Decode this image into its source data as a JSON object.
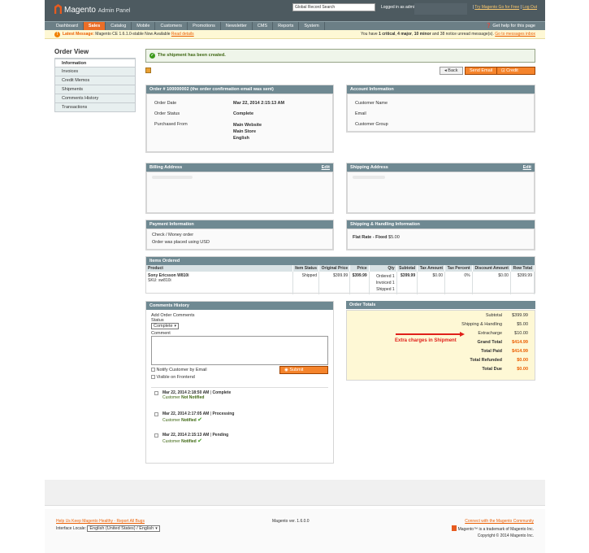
{
  "header": {
    "logo_text": "Magento",
    "logo_suffix": "Admin Panel",
    "search_value": "Global Record Search",
    "logged_in": "Logged in as admin",
    "links": [
      "Try Magento Go for Free",
      "Log Out"
    ]
  },
  "nav": {
    "items": [
      "Dashboard",
      "Sales",
      "Catalog",
      "Mobile",
      "Customers",
      "Promotions",
      "Newsletter",
      "CMS",
      "Reports",
      "System"
    ],
    "active": "Sales",
    "help": "Get help for this page"
  },
  "message_bar": {
    "label": "Latest Message:",
    "text": "Magento CE 1.6.1.0-stable Now Available",
    "read_details": "Read details",
    "counts_prefix": "You have",
    "critical": "1 critical",
    "major": "4 major",
    "minor": "10 minor",
    "rest": "and 38 notice unread message(s).",
    "go_link": "Go to messages inbox"
  },
  "sidebar": {
    "title": "Order View",
    "tabs": [
      "Information",
      "Invoices",
      "Credit Memos",
      "Shipments",
      "Comments History",
      "Transactions"
    ]
  },
  "success": "The shipment has been created.",
  "buttons": {
    "back": "Back",
    "send_email": "Send Email",
    "credit_memo": "Credit Memo"
  },
  "order": {
    "title": "Order # 100000002 (the order confirmation email was sent)",
    "date_label": "Order Date",
    "date": "Mar 22, 2014 2:15:13 AM",
    "status_label": "Order Status",
    "status": "Complete",
    "purchased_label": "Purchased From",
    "purchased": [
      "Main Website",
      "Main Store",
      "English"
    ]
  },
  "account": {
    "title": "Account Information",
    "fields": [
      "Customer Name",
      "Email",
      "Customer Group"
    ]
  },
  "billing": {
    "title": "Billing Address",
    "edit": "Edit"
  },
  "shipping_addr": {
    "title": "Shipping Address",
    "edit": "Edit"
  },
  "payment": {
    "title": "Payment Information",
    "lines": [
      "Check / Money order",
      "Order was placed using USD"
    ]
  },
  "shipping_method": {
    "title": "Shipping & Handling Information",
    "name": "Flat Rate - Fixed",
    "price": "$5.00"
  },
  "items": {
    "title": "Items Ordered",
    "columns": [
      "Product",
      "Item Status",
      "Original Price",
      "Price",
      "Qty",
      "Subtotal",
      "Tax Amount",
      "Tax Percent",
      "Discount Amount",
      "Row Total"
    ],
    "row": {
      "product": "Sony Ericsson W810i",
      "sku": "SKU: sw810i",
      "status": "Shipped",
      "original_price": "$399.99",
      "price": "$399.99",
      "qty": [
        "Ordered 1",
        "Invoiced 1",
        "Shipped 1"
      ],
      "subtotal": "$399.99",
      "tax_amount": "$0.00",
      "tax_percent": "0%",
      "discount": "$0.00",
      "row_total": "$399.99"
    }
  },
  "comments": {
    "title": "Comments History",
    "add_label": "Add Order Comments",
    "status_label": "Status",
    "status_value": "Complete",
    "comment_label": "Comment",
    "notify": "Notify Customer by Email",
    "visible": "Visible on Frontend",
    "submit": "Submit Comment",
    "history": [
      {
        "date": "Mar 22, 2014 2:18:50 AM",
        "sep": "|",
        "status": "Complete",
        "note_prefix": "Customer",
        "note": "Not Notified"
      },
      {
        "date": "Mar 22, 2014 2:17:05 AM",
        "sep": "|",
        "status": "Processing",
        "note_prefix": "Customer",
        "note": "Notified"
      },
      {
        "date": "Mar 22, 2014 2:15:13 AM",
        "sep": "|",
        "status": "Pending",
        "note_prefix": "Customer",
        "note": "Notified"
      }
    ]
  },
  "totals": {
    "title": "Order Totals",
    "rows": [
      {
        "label": "Subtotal",
        "value": "$399.99"
      },
      {
        "label": "Shipping & Handling",
        "value": "$5.00"
      },
      {
        "label": "Extracharge",
        "value": "$10.00"
      },
      {
        "label": "Grand Total",
        "value": "$414.99"
      },
      {
        "label": "Total Paid",
        "value": "$414.99"
      },
      {
        "label": "Total Refunded",
        "value": "$0.00"
      },
      {
        "label": "Total Due",
        "value": "$0.00"
      }
    ],
    "annotation": "Extra charges in Shipment"
  },
  "footer": {
    "report_link": "Help Us Keep Magento Healthy - Report All Bugs",
    "version": "Magento ver. 1.6.0.0",
    "community": "Connect with the Magento Community",
    "locale_label": "Interface Locale:",
    "locale_value": "English (United States) / English",
    "trademark": "Magento™ is a trademark of Magento Inc.",
    "copyright": "Copyright © 2014 Magento Inc."
  }
}
